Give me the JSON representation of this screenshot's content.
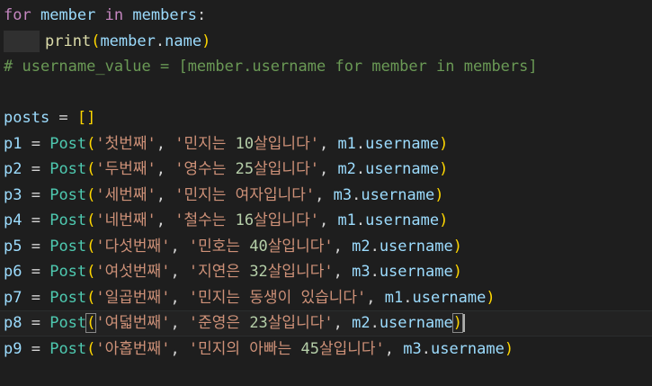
{
  "editor": {
    "line1": {
      "kw_for": "for",
      "var_member": "member",
      "kw_in": "in",
      "var_members": "members",
      "colon": ":"
    },
    "line2": {
      "fn_print": "print",
      "open": "(",
      "obj": "member",
      "dot": ".",
      "attr": "name",
      "close": ")"
    },
    "line3": {
      "comment": "# username_value = [member.username for member in members]"
    },
    "line5": {
      "var": "posts",
      "eq": " = ",
      "brackets": "[]"
    },
    "posts": [
      {
        "var": "p1",
        "cls": "Post",
        "title": "'첫번째'",
        "body_pre": "'민지는 ",
        "num": "10",
        "body_post": "살입니다'",
        "user_var": "m1",
        "attr": "username"
      },
      {
        "var": "p2",
        "cls": "Post",
        "title": "'두번째'",
        "body_pre": "'영수는 ",
        "num": "25",
        "body_post": "살입니다'",
        "user_var": "m2",
        "attr": "username"
      },
      {
        "var": "p3",
        "cls": "Post",
        "title": "'세번째'",
        "body_pre": "'민지는 여자입니다'",
        "num": "",
        "body_post": "",
        "user_var": "m3",
        "attr": "username"
      },
      {
        "var": "p4",
        "cls": "Post",
        "title": "'네번째'",
        "body_pre": "'철수는 ",
        "num": "16",
        "body_post": "살입니다'",
        "user_var": "m1",
        "attr": "username"
      },
      {
        "var": "p5",
        "cls": "Post",
        "title": "'다섯번째'",
        "body_pre": "'민호는 ",
        "num": "40",
        "body_post": "살입니다'",
        "user_var": "m2",
        "attr": "username"
      },
      {
        "var": "p6",
        "cls": "Post",
        "title": "'여섯번째'",
        "body_pre": "'지연은 ",
        "num": "32",
        "body_post": "살입니다'",
        "user_var": "m3",
        "attr": "username"
      },
      {
        "var": "p7",
        "cls": "Post",
        "title": "'일곱번째'",
        "body_pre": "'민지는 동생이 있습니다'",
        "num": "",
        "body_post": "",
        "user_var": "m1",
        "attr": "username"
      },
      {
        "var": "p8",
        "cls": "Post",
        "title": "'여덟번째'",
        "body_pre": "'준영은 ",
        "num": "23",
        "body_post": "살입니다'",
        "user_var": "m2",
        "attr": "username"
      },
      {
        "var": "p9",
        "cls": "Post",
        "title": "'아홉번째'",
        "body_pre": "'민지의 아빠는 ",
        "num": "45",
        "body_post": "살입니다'",
        "user_var": "m3",
        "attr": "username"
      }
    ],
    "tokens": {
      "eq": " = ",
      "open": "(",
      "close": ")",
      "comma": ", ",
      "dot": "."
    }
  },
  "colors": {
    "background": "#1e1e1e",
    "keyword": "#c586c0",
    "variable": "#9cdcfe",
    "function": "#dcdcaa",
    "class": "#4ec9b0",
    "string": "#ce9178",
    "number": "#b5cea8",
    "comment": "#6a9955"
  }
}
